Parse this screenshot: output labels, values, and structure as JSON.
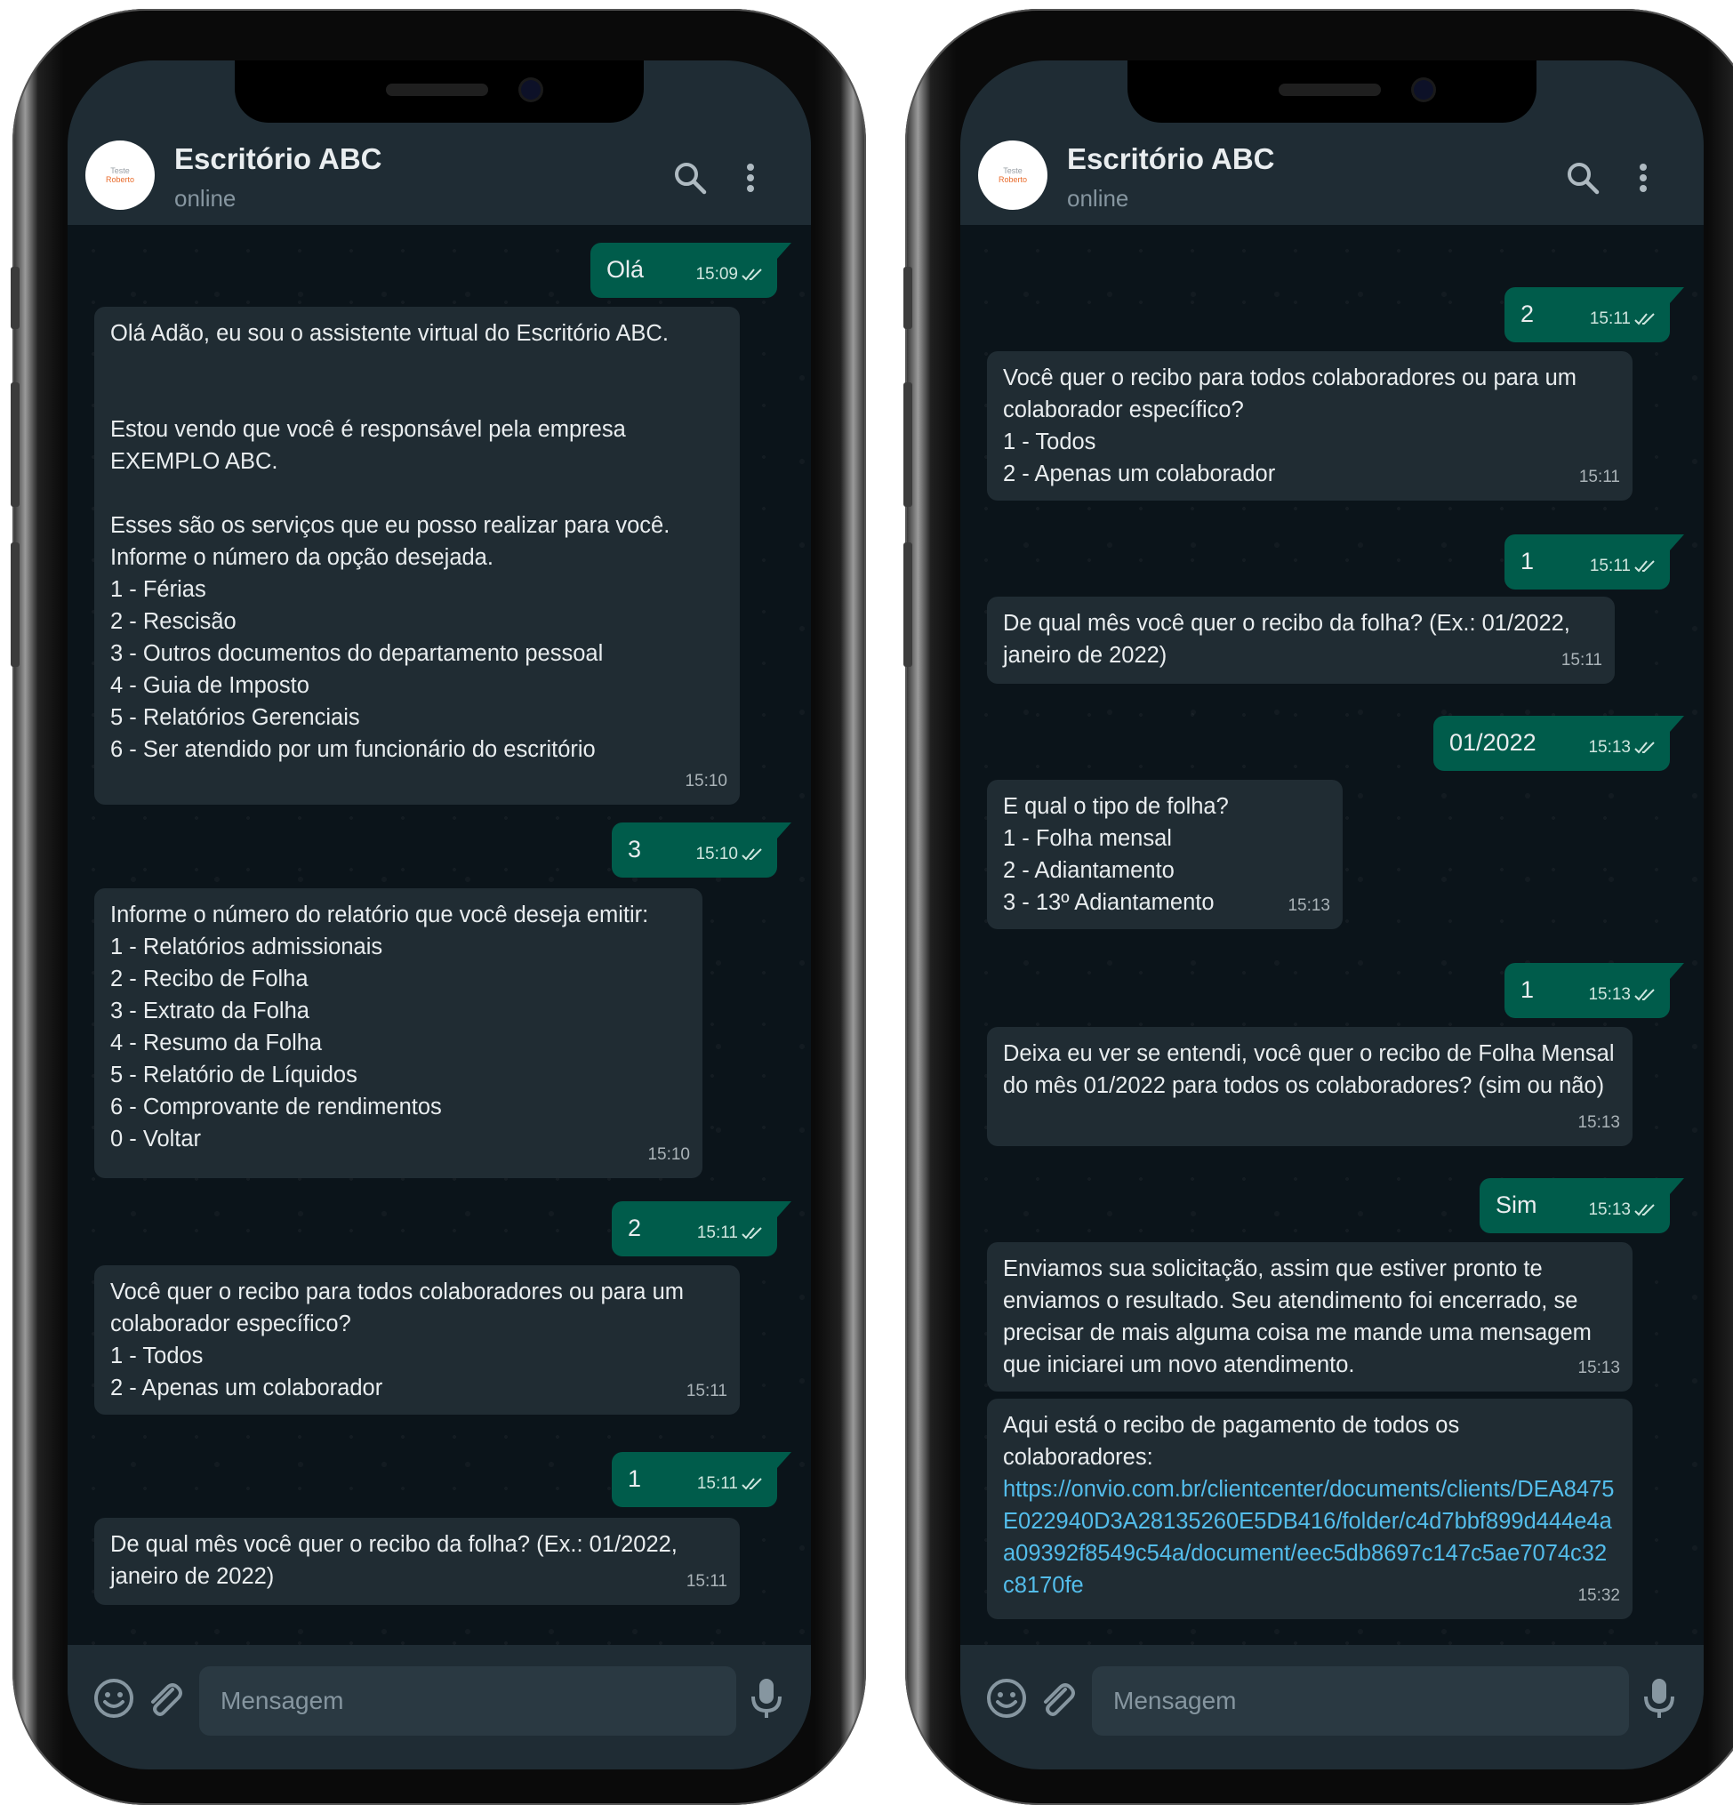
{
  "chat": {
    "avatar_text_1": "Teste",
    "avatar_text_2": "Roberto",
    "name": "Escritório ABC",
    "status": "online",
    "input_placeholder": "Mensagem"
  },
  "icons": [
    "search-icon",
    "more-vert-icon",
    "emoji-icon",
    "attach-icon",
    "mic-icon",
    "double-check-icon"
  ],
  "colors": {
    "header": "#1f2c34",
    "chat_background": "#0b141a",
    "incoming_bubble": "#202c33",
    "outgoing_bubble": "#005c4b",
    "link": "#53bdeb"
  },
  "left_messages": [
    {
      "dir": "out",
      "text": "Olá",
      "time": "15:09"
    },
    {
      "dir": "in",
      "text": "Olá Adão, eu sou o assistente virtual do Escritório ABC.\n\n\nEstou vendo que você é responsável pela empresa EXEMPLO ABC.\n\nEsses são os serviços que eu posso realizar para você.\nInforme o número da opção desejada.\n1 - Férias\n2 - Rescisão\n3 - Outros documentos do departamento pessoal\n4 - Guia de Imposto\n5 - Relatórios Gerenciais\n6 - Ser atendido por um funcionário do escritório",
      "time": "15:10"
    },
    {
      "dir": "out",
      "text": "3",
      "time": "15:10"
    },
    {
      "dir": "in",
      "text": "Informe o número do relatório que você deseja emitir:\n1 - Relatórios admissionais\n2 - Recibo de Folha\n3 - Extrato da Folha\n4 - Resumo da Folha\n5 - Relatório de Líquidos\n6 - Comprovante de rendimentos\n0 - Voltar",
      "time": "15:10"
    },
    {
      "dir": "out",
      "text": "2",
      "time": "15:11"
    },
    {
      "dir": "in",
      "text": "Você quer o recibo para todos colaboradores ou para um colaborador específico?\n1 - Todos\n2 -  Apenas um colaborador",
      "time": "15:11"
    },
    {
      "dir": "out",
      "text": "1",
      "time": "15:11"
    },
    {
      "dir": "in",
      "text": "De qual mês você quer o recibo da folha? (Ex.: 01/2022, janeiro de 2022)",
      "time": "15:11"
    }
  ],
  "right_messages": [
    {
      "dir": "out",
      "text": "2",
      "time": "15:11"
    },
    {
      "dir": "in",
      "text": "Você quer o recibo para todos colaboradores ou para um colaborador específico?\n1 - Todos\n2 -  Apenas um colaborador",
      "time": "15:11"
    },
    {
      "dir": "out",
      "text": "1",
      "time": "15:11"
    },
    {
      "dir": "in",
      "text": "De qual mês você quer o recibo da folha? (Ex.: 01/2022, janeiro de 2022)",
      "time": "15:11"
    },
    {
      "dir": "out",
      "text": "01/2022",
      "time": "15:13"
    },
    {
      "dir": "in",
      "text": "E qual o tipo de folha?\n1 - Folha mensal\n2 - Adiantamento\n3 - 13º Adiantamento",
      "time": "15:13"
    },
    {
      "dir": "out",
      "text": "1",
      "time": "15:13"
    },
    {
      "dir": "in",
      "text": "Deixa eu ver se entendi, você quer o recibo de Folha Mensal do mês 01/2022 para todos os colaboradores? (sim ou não)",
      "time": "15:13"
    },
    {
      "dir": "out",
      "text": "Sim",
      "time": "15:13"
    },
    {
      "dir": "in",
      "text": "Enviamos sua solicitação, assim que estiver pronto te enviamos o resultado. Seu atendimento foi encerrado, se precisar de mais alguma coisa me mande uma mensagem que iniciarei um novo atendimento.",
      "time": "15:13"
    },
    {
      "dir": "in",
      "text": "Aqui está o recibo de pagamento de todos os colaboradores:",
      "link": "https://onvio.com.br/clientcenter/documents/clients/DEA8475E022940D3A28135260E5DB416/folder/c4d7bbf899d444e4aa09392f8549c54a/document/eec5db8697c147c5ae7074c32c8170fe",
      "time": "15:32"
    }
  ]
}
